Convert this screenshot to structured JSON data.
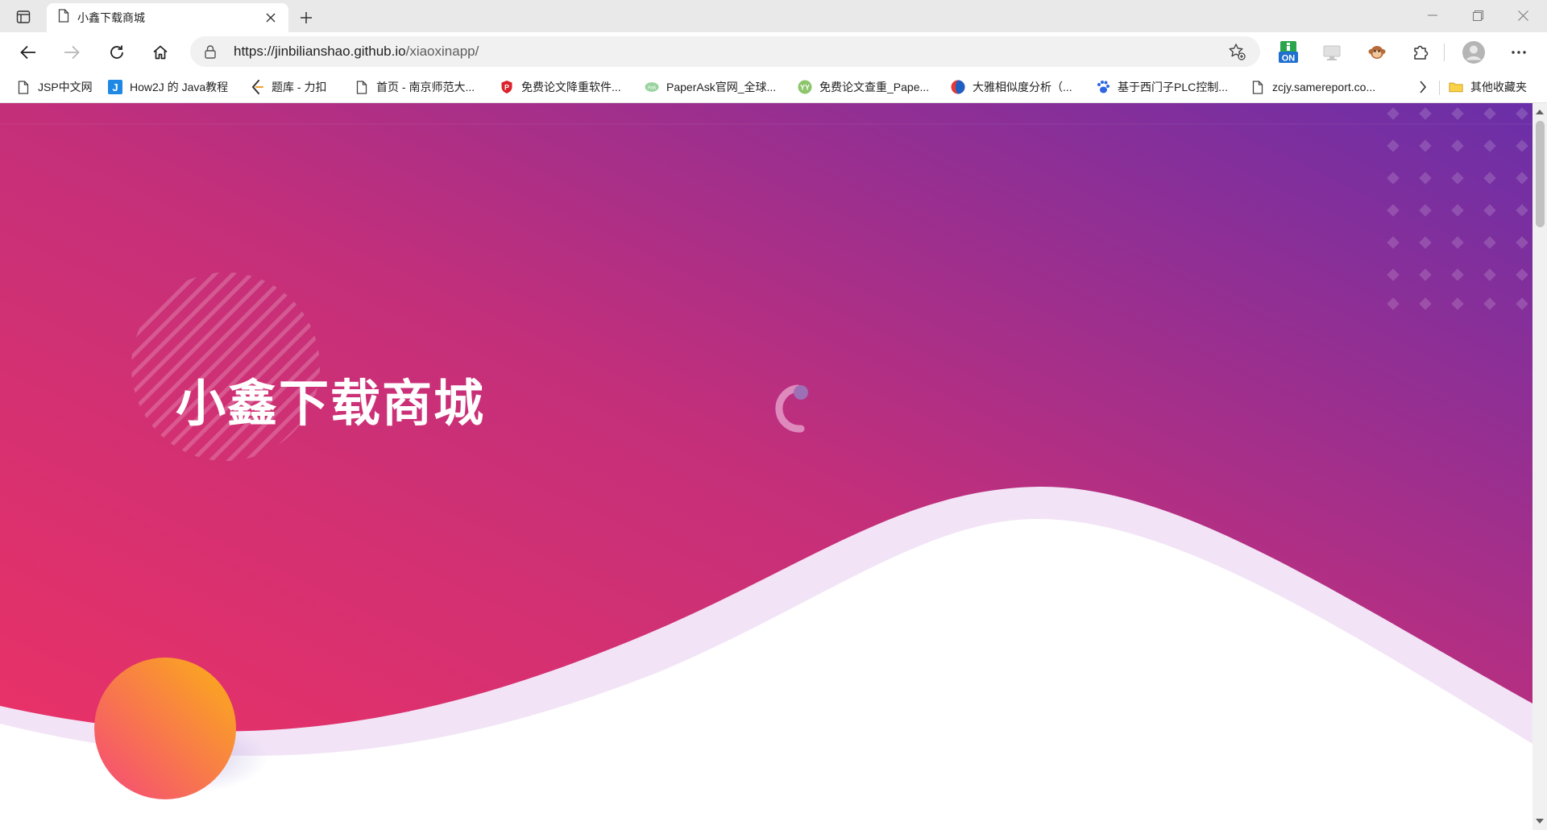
{
  "browser": {
    "tab_title": "小鑫下载商城",
    "url_host": "https://jinbilianshao.github.io",
    "url_path": "/xiaoxinapp/",
    "bookmarks": [
      {
        "label": "JSP中文网",
        "icon": "page-icon"
      },
      {
        "label": "How2J 的 Java教程",
        "icon": "how2j-icon"
      },
      {
        "label": "题库 - 力扣",
        "icon": "leetcode-icon"
      },
      {
        "label": "首页 - 南京师范大...",
        "icon": "page-icon"
      },
      {
        "label": "免费论文降重软件...",
        "icon": "shield-icon"
      },
      {
        "label": "PaperAsk官网_全球...",
        "icon": "paperask-icon"
      },
      {
        "label": "免费论文查重_Pape...",
        "icon": "paperyy-icon"
      },
      {
        "label": "大雅相似度分析（...",
        "icon": "daya-icon"
      },
      {
        "label": "基于西门子PLC控制...",
        "icon": "paw-icon"
      },
      {
        "label": "zcjy.samereport.co...",
        "icon": "page-icon"
      }
    ],
    "other_bookmarks": "其他收藏夹",
    "extension_badge": "ON"
  },
  "page": {
    "hero_title": "小鑫下载商城"
  },
  "colors": {
    "gradient_start": "#ee3264",
    "gradient_end": "#6a2fa8",
    "wave_light": "#f2e4f6",
    "orb_start": "#f5487a",
    "orb_end": "#fbb016"
  }
}
